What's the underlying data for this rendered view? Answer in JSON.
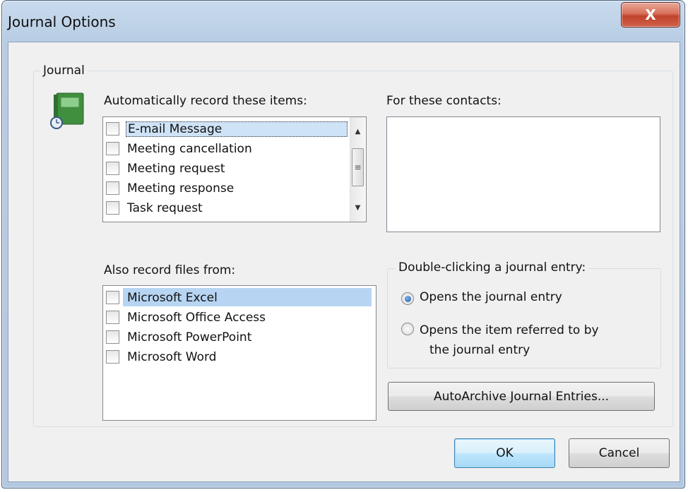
{
  "window": {
    "title": "Journal Options",
    "close_glyph": "X"
  },
  "group": {
    "label": "Journal"
  },
  "auto_record": {
    "label": "Automatically record these items:",
    "items": [
      {
        "label": "E-mail Message",
        "checked": false
      },
      {
        "label": "Meeting cancellation",
        "checked": false
      },
      {
        "label": "Meeting request",
        "checked": false
      },
      {
        "label": "Meeting response",
        "checked": false
      },
      {
        "label": "Task request",
        "checked": false
      }
    ]
  },
  "contacts": {
    "label": "For these contacts:"
  },
  "files_from": {
    "label": "Also record files from:",
    "items": [
      {
        "label": "Microsoft Excel",
        "checked": false
      },
      {
        "label": "Microsoft Office Access",
        "checked": false
      },
      {
        "label": "Microsoft PowerPoint",
        "checked": false
      },
      {
        "label": "Microsoft Word",
        "checked": false
      }
    ]
  },
  "double_click": {
    "label": "Double-clicking a journal entry:",
    "option1": "Opens the journal entry",
    "option2_line1": "Opens the item referred to by",
    "option2_line2": "the journal entry",
    "selected": "option1"
  },
  "buttons": {
    "autoarchive": "AutoArchive Journal Entries...",
    "ok": "OK",
    "cancel": "Cancel"
  },
  "colors": {
    "selection": "#b7d5f2",
    "default_button_border": "#3c7fb1",
    "close_button": "#c0432b"
  },
  "icons": {
    "journal": "journal-book-clock-icon",
    "scroll_up": "scroll-up-arrow-icon",
    "scroll_down": "scroll-down-arrow-icon",
    "close": "close-icon"
  }
}
